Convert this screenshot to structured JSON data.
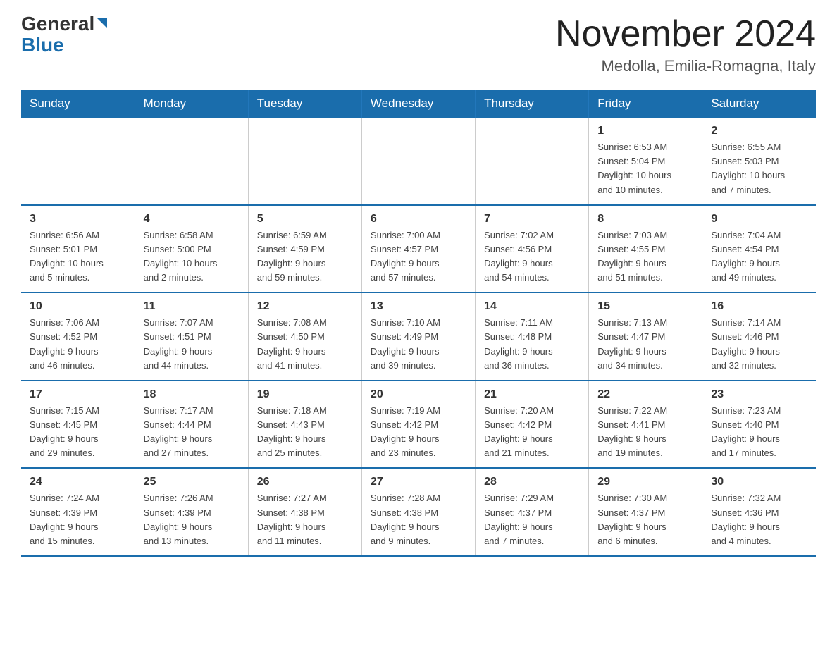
{
  "header": {
    "logo_general": "General",
    "logo_blue": "Blue",
    "calendar_title": "November 2024",
    "calendar_subtitle": "Medolla, Emilia-Romagna, Italy"
  },
  "weekdays": [
    "Sunday",
    "Monday",
    "Tuesday",
    "Wednesday",
    "Thursday",
    "Friday",
    "Saturday"
  ],
  "weeks": [
    [
      {
        "day": "",
        "info": ""
      },
      {
        "day": "",
        "info": ""
      },
      {
        "day": "",
        "info": ""
      },
      {
        "day": "",
        "info": ""
      },
      {
        "day": "",
        "info": ""
      },
      {
        "day": "1",
        "info": "Sunrise: 6:53 AM\nSunset: 5:04 PM\nDaylight: 10 hours\nand 10 minutes."
      },
      {
        "day": "2",
        "info": "Sunrise: 6:55 AM\nSunset: 5:03 PM\nDaylight: 10 hours\nand 7 minutes."
      }
    ],
    [
      {
        "day": "3",
        "info": "Sunrise: 6:56 AM\nSunset: 5:01 PM\nDaylight: 10 hours\nand 5 minutes."
      },
      {
        "day": "4",
        "info": "Sunrise: 6:58 AM\nSunset: 5:00 PM\nDaylight: 10 hours\nand 2 minutes."
      },
      {
        "day": "5",
        "info": "Sunrise: 6:59 AM\nSunset: 4:59 PM\nDaylight: 9 hours\nand 59 minutes."
      },
      {
        "day": "6",
        "info": "Sunrise: 7:00 AM\nSunset: 4:57 PM\nDaylight: 9 hours\nand 57 minutes."
      },
      {
        "day": "7",
        "info": "Sunrise: 7:02 AM\nSunset: 4:56 PM\nDaylight: 9 hours\nand 54 minutes."
      },
      {
        "day": "8",
        "info": "Sunrise: 7:03 AM\nSunset: 4:55 PM\nDaylight: 9 hours\nand 51 minutes."
      },
      {
        "day": "9",
        "info": "Sunrise: 7:04 AM\nSunset: 4:54 PM\nDaylight: 9 hours\nand 49 minutes."
      }
    ],
    [
      {
        "day": "10",
        "info": "Sunrise: 7:06 AM\nSunset: 4:52 PM\nDaylight: 9 hours\nand 46 minutes."
      },
      {
        "day": "11",
        "info": "Sunrise: 7:07 AM\nSunset: 4:51 PM\nDaylight: 9 hours\nand 44 minutes."
      },
      {
        "day": "12",
        "info": "Sunrise: 7:08 AM\nSunset: 4:50 PM\nDaylight: 9 hours\nand 41 minutes."
      },
      {
        "day": "13",
        "info": "Sunrise: 7:10 AM\nSunset: 4:49 PM\nDaylight: 9 hours\nand 39 minutes."
      },
      {
        "day": "14",
        "info": "Sunrise: 7:11 AM\nSunset: 4:48 PM\nDaylight: 9 hours\nand 36 minutes."
      },
      {
        "day": "15",
        "info": "Sunrise: 7:13 AM\nSunset: 4:47 PM\nDaylight: 9 hours\nand 34 minutes."
      },
      {
        "day": "16",
        "info": "Sunrise: 7:14 AM\nSunset: 4:46 PM\nDaylight: 9 hours\nand 32 minutes."
      }
    ],
    [
      {
        "day": "17",
        "info": "Sunrise: 7:15 AM\nSunset: 4:45 PM\nDaylight: 9 hours\nand 29 minutes."
      },
      {
        "day": "18",
        "info": "Sunrise: 7:17 AM\nSunset: 4:44 PM\nDaylight: 9 hours\nand 27 minutes."
      },
      {
        "day": "19",
        "info": "Sunrise: 7:18 AM\nSunset: 4:43 PM\nDaylight: 9 hours\nand 25 minutes."
      },
      {
        "day": "20",
        "info": "Sunrise: 7:19 AM\nSunset: 4:42 PM\nDaylight: 9 hours\nand 23 minutes."
      },
      {
        "day": "21",
        "info": "Sunrise: 7:20 AM\nSunset: 4:42 PM\nDaylight: 9 hours\nand 21 minutes."
      },
      {
        "day": "22",
        "info": "Sunrise: 7:22 AM\nSunset: 4:41 PM\nDaylight: 9 hours\nand 19 minutes."
      },
      {
        "day": "23",
        "info": "Sunrise: 7:23 AM\nSunset: 4:40 PM\nDaylight: 9 hours\nand 17 minutes."
      }
    ],
    [
      {
        "day": "24",
        "info": "Sunrise: 7:24 AM\nSunset: 4:39 PM\nDaylight: 9 hours\nand 15 minutes."
      },
      {
        "day": "25",
        "info": "Sunrise: 7:26 AM\nSunset: 4:39 PM\nDaylight: 9 hours\nand 13 minutes."
      },
      {
        "day": "26",
        "info": "Sunrise: 7:27 AM\nSunset: 4:38 PM\nDaylight: 9 hours\nand 11 minutes."
      },
      {
        "day": "27",
        "info": "Sunrise: 7:28 AM\nSunset: 4:38 PM\nDaylight: 9 hours\nand 9 minutes."
      },
      {
        "day": "28",
        "info": "Sunrise: 7:29 AM\nSunset: 4:37 PM\nDaylight: 9 hours\nand 7 minutes."
      },
      {
        "day": "29",
        "info": "Sunrise: 7:30 AM\nSunset: 4:37 PM\nDaylight: 9 hours\nand 6 minutes."
      },
      {
        "day": "30",
        "info": "Sunrise: 7:32 AM\nSunset: 4:36 PM\nDaylight: 9 hours\nand 4 minutes."
      }
    ]
  ]
}
